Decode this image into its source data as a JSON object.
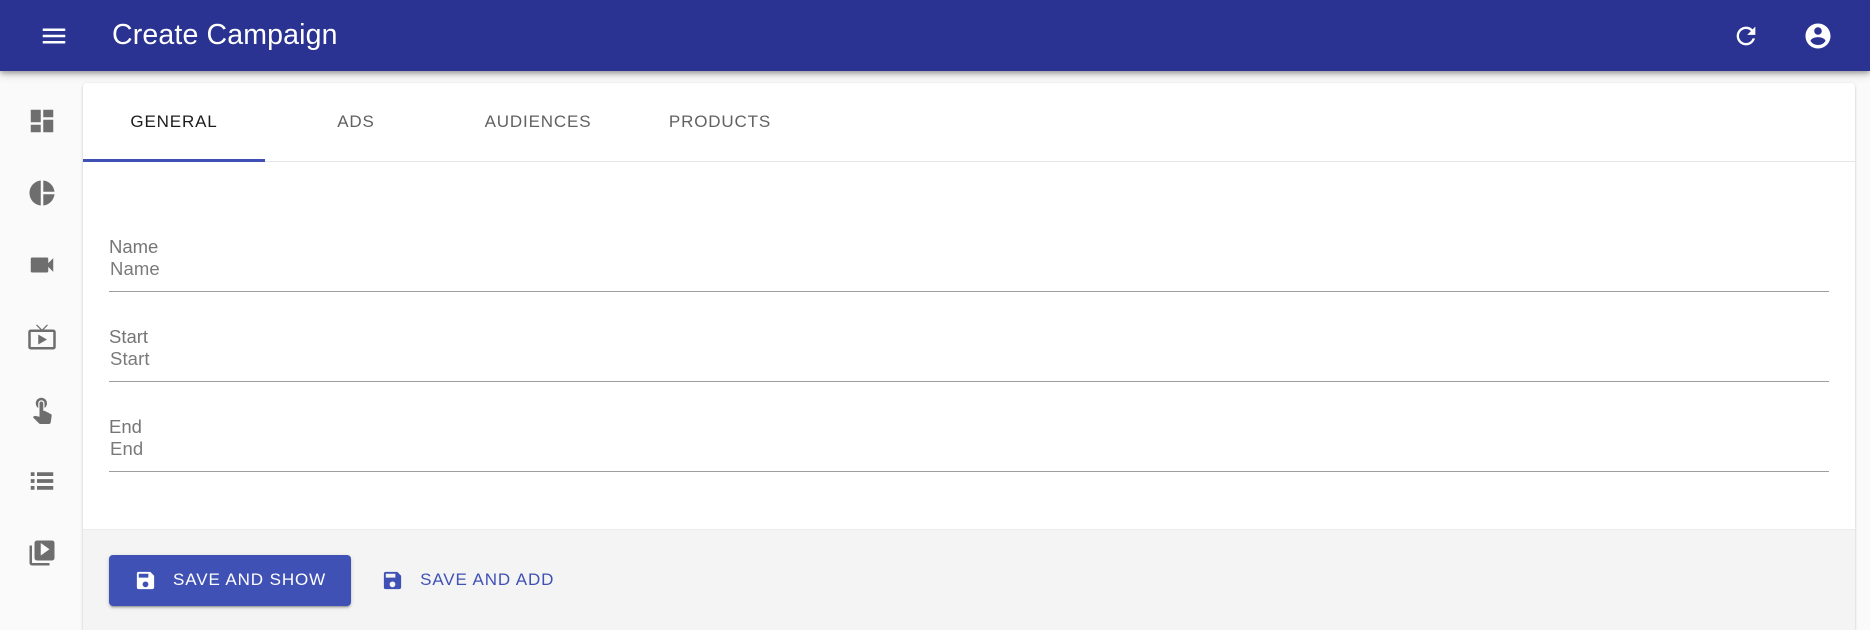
{
  "appbar": {
    "menu_icon": "hamburger-menu-icon",
    "title": "Create Campaign",
    "refresh_icon": "refresh-icon",
    "account_icon": "account-circle-icon",
    "background_color": "#2a3392",
    "text_color": "#ffffff"
  },
  "sidebar": {
    "items": [
      {
        "icon": "dashboard-icon",
        "name": "dashboard"
      },
      {
        "icon": "pie-chart-icon",
        "name": "reports"
      },
      {
        "icon": "videocam-icon",
        "name": "videos"
      },
      {
        "icon": "live-tv-icon",
        "name": "channels"
      },
      {
        "icon": "touch-app-icon",
        "name": "interactions"
      },
      {
        "icon": "list-icon",
        "name": "playlists"
      },
      {
        "icon": "video-library-icon",
        "name": "library"
      }
    ],
    "icon_color": "#6e6e6e"
  },
  "tabs": {
    "active_index": 0,
    "items": [
      {
        "label": "GENERAL"
      },
      {
        "label": "ADS"
      },
      {
        "label": "AUDIENCES"
      },
      {
        "label": "PRODUCTS"
      }
    ],
    "indicator_color": "#3f51b5",
    "active_color": "#1c1c1c",
    "inactive_color": "#616161"
  },
  "form": {
    "fields": [
      {
        "label": "Name",
        "value": "",
        "placeholder": "Name"
      },
      {
        "label": "Start",
        "value": "",
        "placeholder": "Start"
      },
      {
        "label": "End",
        "value": "",
        "placeholder": "End"
      }
    ]
  },
  "actions": {
    "background_color": "#f4f4f4",
    "primary": {
      "label": "SAVE AND SHOW",
      "icon": "save-icon",
      "background_color": "#3f51b5",
      "text_color": "#ffffff"
    },
    "secondary": {
      "label": "SAVE AND ADD",
      "icon": "save-icon",
      "text_color": "#3f51b5"
    }
  }
}
